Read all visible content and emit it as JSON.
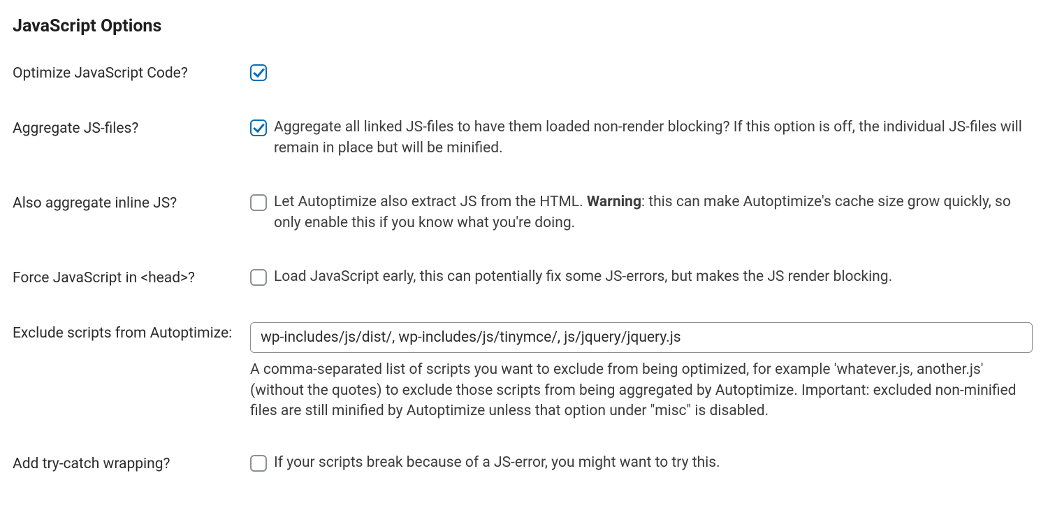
{
  "section": {
    "title": "JavaScript Options"
  },
  "options": {
    "optimize": {
      "label": "Optimize JavaScript Code?"
    },
    "aggregate": {
      "label": "Aggregate JS-files?",
      "desc": "Aggregate all linked JS-files to have them loaded non-render blocking? If this option is off, the individual JS-files will remain in place but will be minified."
    },
    "inline": {
      "label": "Also aggregate inline JS?",
      "desc_pre": "Let Autoptimize also extract JS from the HTML. ",
      "warn": "Warning",
      "desc_post": ": this can make Autoptimize's cache size grow quickly, so only enable this if you know what you're doing."
    },
    "forcehead": {
      "label": "Force JavaScript in <head>?",
      "desc": "Load JavaScript early, this can potentially fix some JS-errors, but makes the JS render blocking."
    },
    "exclude": {
      "label": "Exclude scripts from Autoptimize:",
      "value": "wp-includes/js/dist/, wp-includes/js/tinymce/, js/jquery/jquery.js",
      "help": "A comma-separated list of scripts you want to exclude from being optimized, for example 'whatever.js, another.js' (without the quotes) to exclude those scripts from being aggregated by Autoptimize. Important: excluded non-minified files are still minified by Autoptimize unless that option under \"misc\" is disabled."
    },
    "trycatch": {
      "label": "Add try-catch wrapping?",
      "desc": "If your scripts break because of a JS-error, you might want to try this."
    }
  }
}
